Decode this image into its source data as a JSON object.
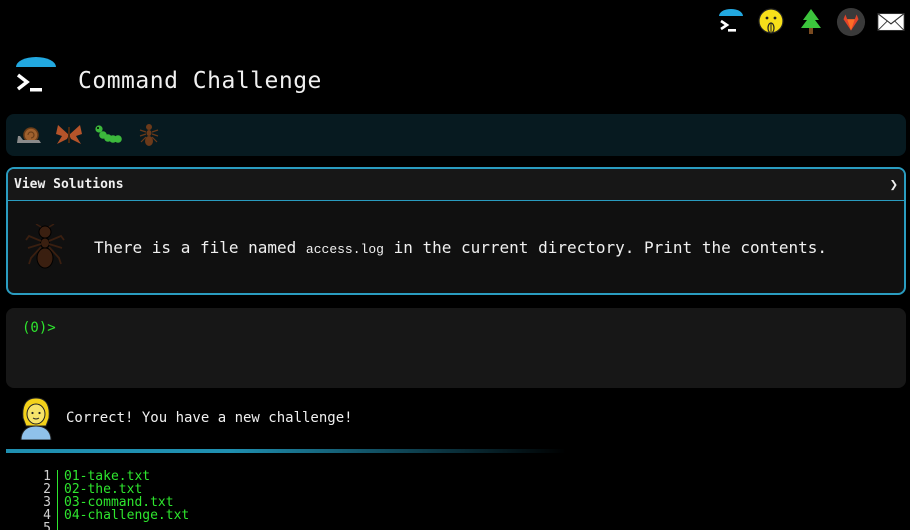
{
  "top_nav": {
    "icons": [
      "terminal-icon",
      "shushing-face-icon",
      "christmas-tree-icon",
      "gitlab-icon",
      "envelope-icon"
    ]
  },
  "header": {
    "title": "Command Challenge"
  },
  "levels": {
    "icons": [
      "snail-icon",
      "butterfly-icon",
      "caterpillar-icon",
      "ant-icon"
    ]
  },
  "challenge": {
    "solutions_label": "View Solutions",
    "chevron": "❯",
    "text_before": "There is a file named ",
    "filename": "access.log",
    "text_after": " in the current directory. Print the contents."
  },
  "terminal": {
    "prompt": "(0)>"
  },
  "feedback": {
    "message": "Correct! You have a new challenge!"
  },
  "output": {
    "lines": [
      {
        "num": "1",
        "text": "01-take.txt"
      },
      {
        "num": "2",
        "text": "02-the.txt"
      },
      {
        "num": "3",
        "text": "03-command.txt"
      },
      {
        "num": "4",
        "text": "04-challenge.txt"
      },
      {
        "num": "5",
        "text": ""
      }
    ]
  },
  "colors": {
    "accent": "#2a9cc0",
    "terminal_green": "#2ee62e",
    "background": "#000000"
  }
}
